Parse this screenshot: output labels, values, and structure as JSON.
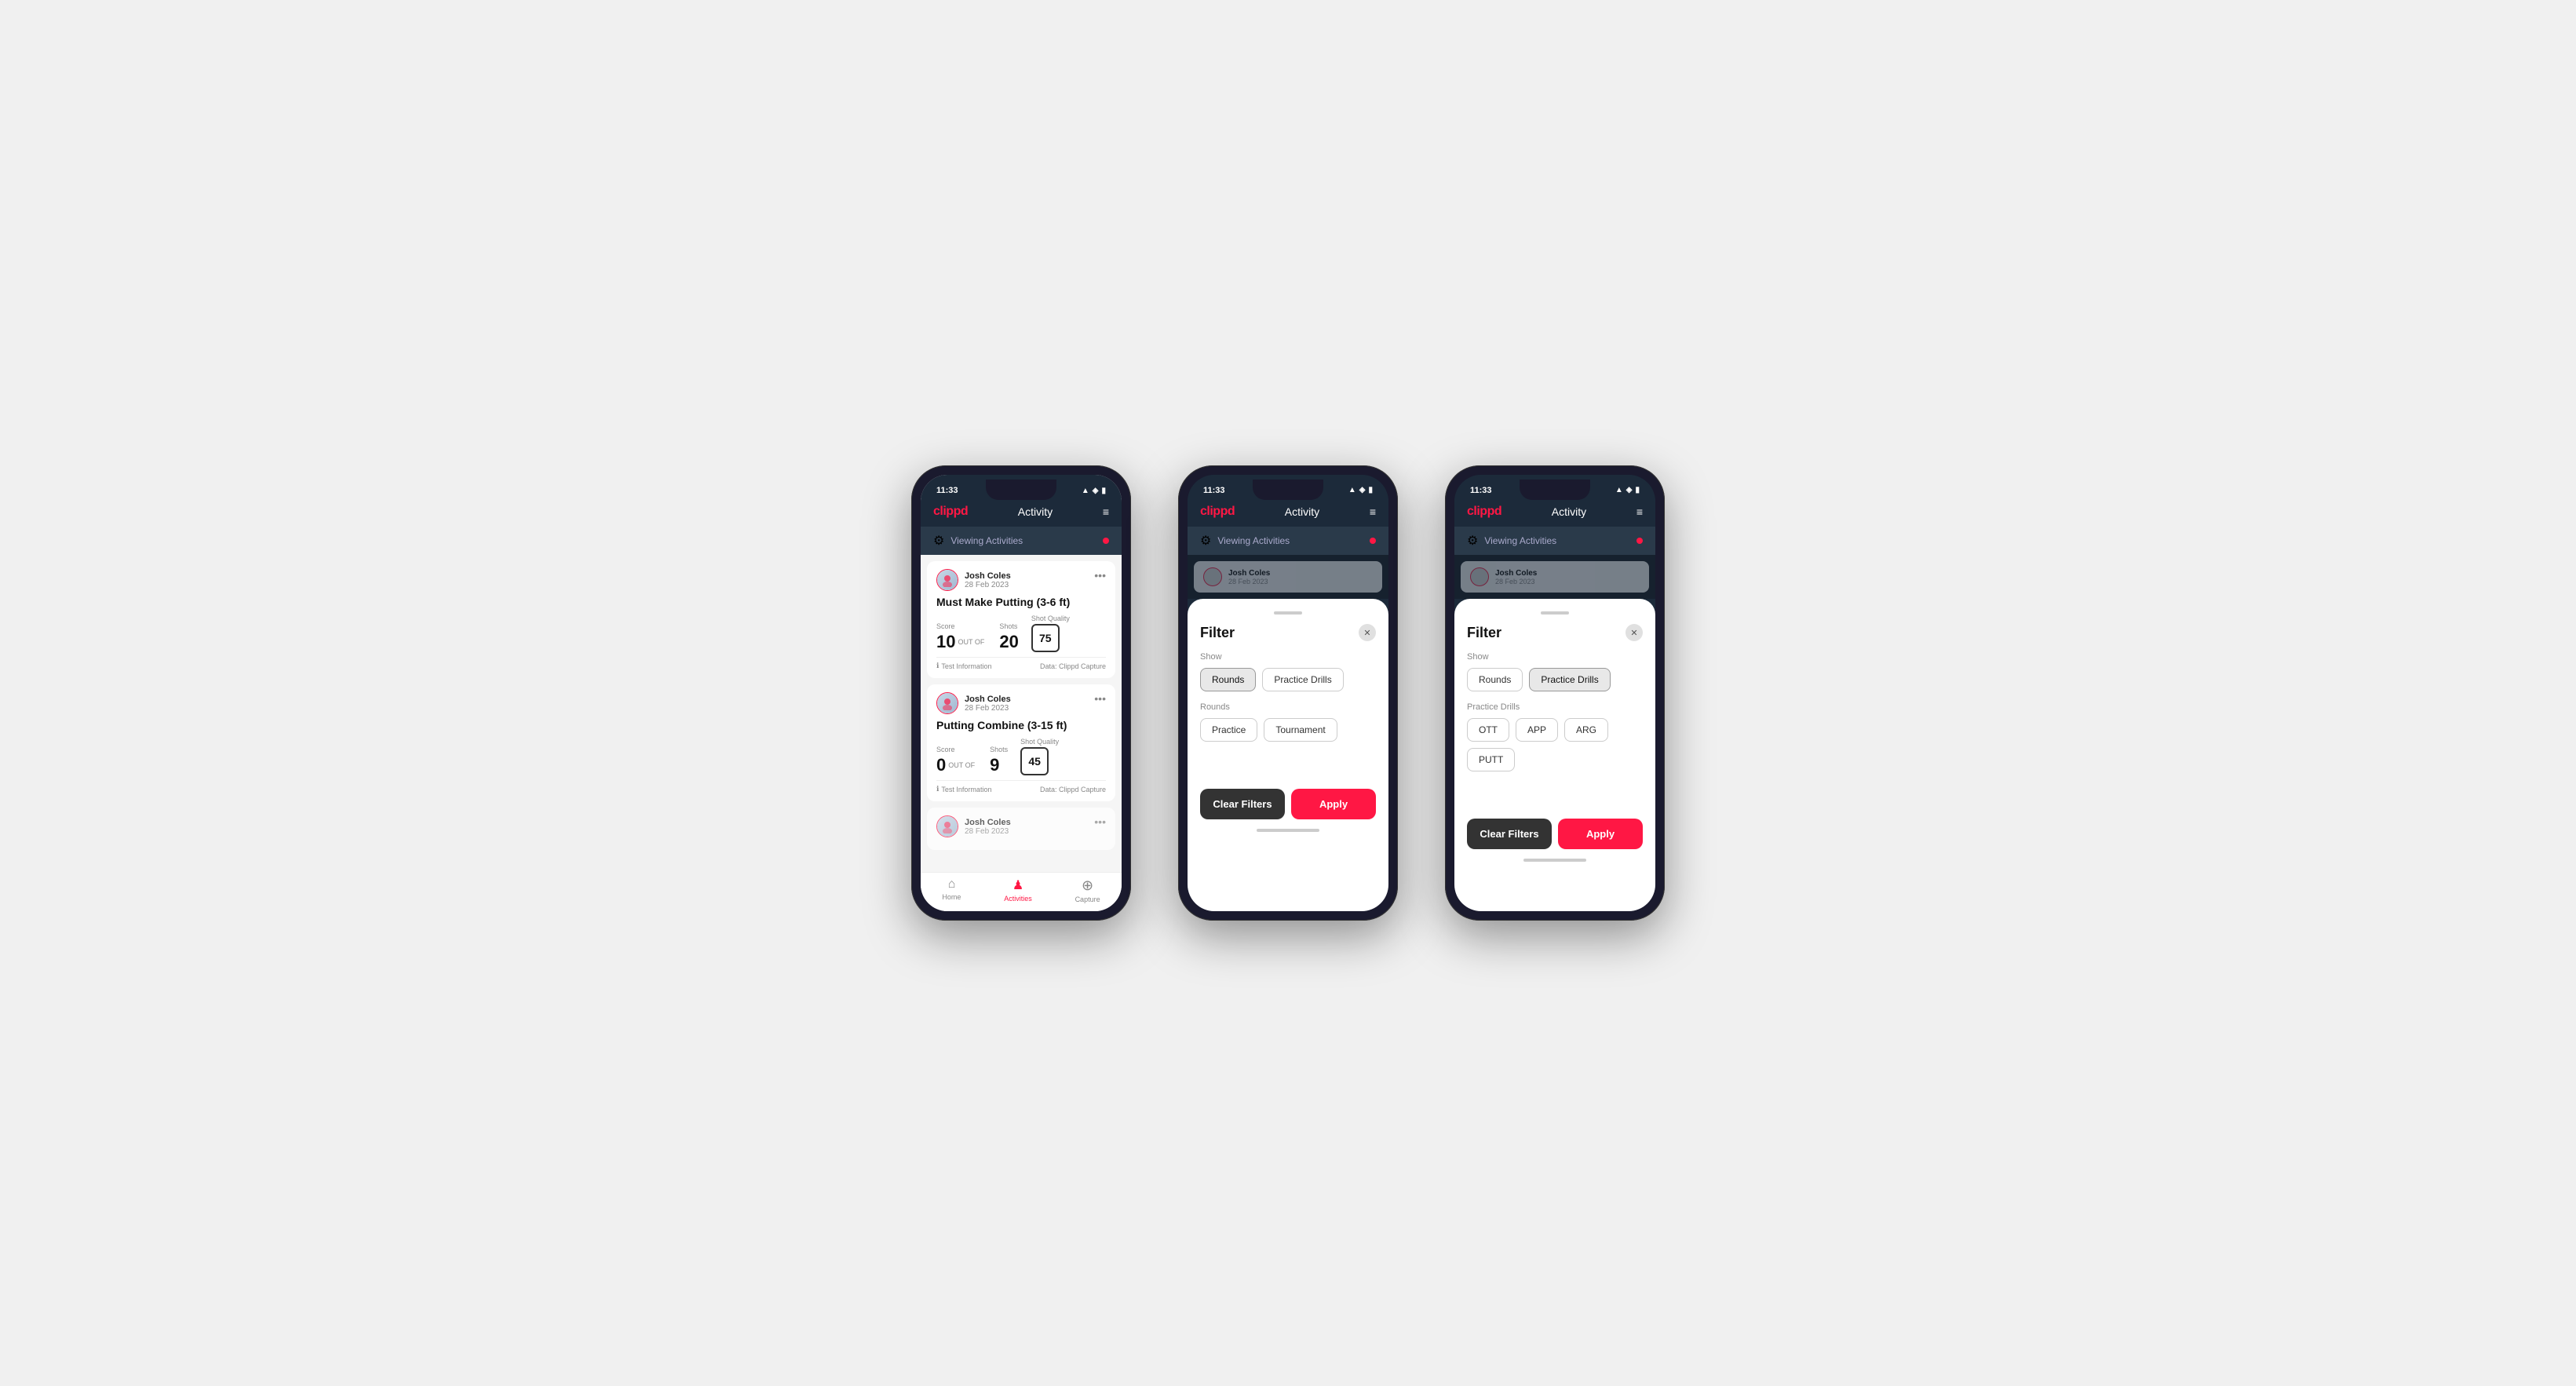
{
  "app": {
    "logo": "clippd",
    "header_title": "Activity",
    "time": "11:33",
    "status_icons": "▲ ◈ ☰",
    "hamburger": "≡",
    "viewing_activities": "Viewing Activities",
    "red_dot": true
  },
  "phone1": {
    "cards": [
      {
        "user_name": "Josh Coles",
        "user_date": "28 Feb 2023",
        "title": "Must Make Putting (3-6 ft)",
        "score_label": "Score",
        "score_value": "10",
        "out_of": "OUT OF",
        "shots_label": "Shots",
        "shots_value": "20",
        "sq_label": "Shot Quality",
        "sq_value": "75",
        "footer_left": "Test Information",
        "footer_right": "Data: Clippd Capture"
      },
      {
        "user_name": "Josh Coles",
        "user_date": "28 Feb 2023",
        "title": "Putting Combine (3-15 ft)",
        "score_label": "Score",
        "score_value": "0",
        "out_of": "OUT OF",
        "shots_label": "Shots",
        "shots_value": "9",
        "sq_label": "Shot Quality",
        "sq_value": "45",
        "footer_left": "Test Information",
        "footer_right": "Data: Clippd Capture"
      }
    ],
    "nav": [
      {
        "label": "Home",
        "icon": "⌂",
        "active": false
      },
      {
        "label": "Activities",
        "icon": "♟",
        "active": true
      },
      {
        "label": "Capture",
        "icon": "+",
        "active": false
      }
    ]
  },
  "phone2": {
    "filter": {
      "title": "Filter",
      "show_label": "Show",
      "show_buttons": [
        {
          "label": "Rounds",
          "selected": true
        },
        {
          "label": "Practice Drills",
          "selected": false
        }
      ],
      "rounds_label": "Rounds",
      "rounds_buttons": [
        {
          "label": "Practice",
          "selected": false
        },
        {
          "label": "Tournament",
          "selected": false
        }
      ],
      "clear_label": "Clear Filters",
      "apply_label": "Apply"
    }
  },
  "phone3": {
    "filter": {
      "title": "Filter",
      "show_label": "Show",
      "show_buttons": [
        {
          "label": "Rounds",
          "selected": false
        },
        {
          "label": "Practice Drills",
          "selected": true
        }
      ],
      "drills_label": "Practice Drills",
      "drills_buttons": [
        {
          "label": "OTT",
          "selected": false
        },
        {
          "label": "APP",
          "selected": false
        },
        {
          "label": "ARG",
          "selected": false
        },
        {
          "label": "PUTT",
          "selected": false
        }
      ],
      "clear_label": "Clear Filters",
      "apply_label": "Apply"
    }
  }
}
